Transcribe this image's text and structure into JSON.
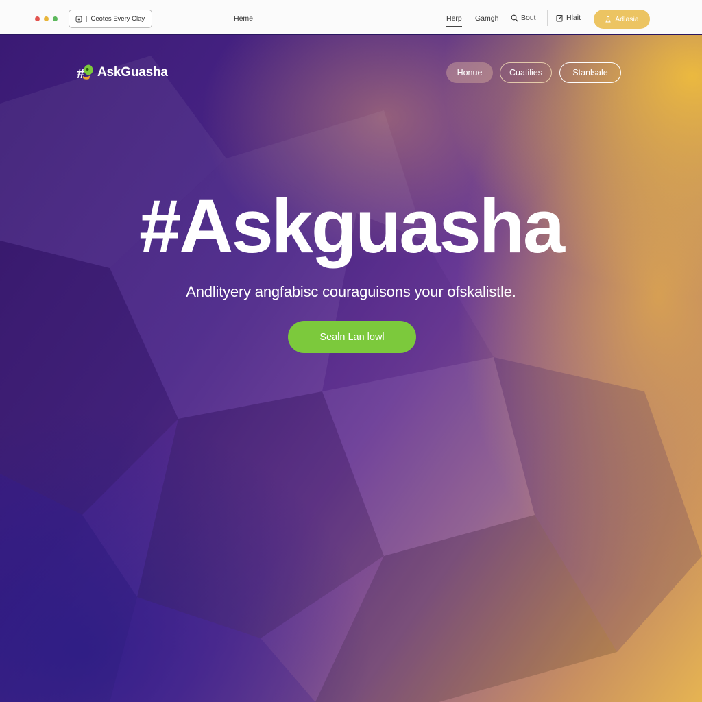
{
  "browser": {
    "address_text": "Ceotes Every Clay",
    "tabs": [
      {
        "label": "Heme"
      },
      {
        "label": "Herp"
      },
      {
        "label": "Gamgh"
      }
    ],
    "search_label": "Bout",
    "edit_label": "Hlait",
    "cta_label": "Adlasia"
  },
  "header": {
    "logo_text": "AskGuasha",
    "nav": [
      {
        "label": "Honue"
      },
      {
        "label": "Cuatilies"
      },
      {
        "label": "Stanlsale"
      }
    ]
  },
  "hero": {
    "headline": "#Askguasha",
    "subtitle": "Andlityery angfabisc couraguisons your ofskalistle.",
    "cta_label": "Sealn Lan lowl"
  },
  "colors": {
    "accent_green": "#7cc93c",
    "accent_gold": "#ecc462",
    "bg_purple": "#3a1a74"
  }
}
